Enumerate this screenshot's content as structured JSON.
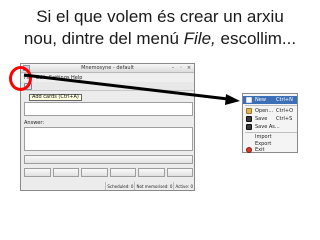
{
  "caption": {
    "line1": "Si el que volem és crear un arxiu",
    "line2_before": "nou, dintre del menú ",
    "line2_menu": "File,",
    "line2_after": " escollim..."
  },
  "window": {
    "title": "Mnemosyne - default",
    "controls": [
      "–",
      "◦",
      "×"
    ],
    "menus": [
      "File",
      "Edit",
      "Settings",
      "Help"
    ],
    "toolbar_icon": "new-card-icon",
    "tooltip": "Add cards (Ctrl+A)",
    "answer_label": "Answer:",
    "status": {
      "scheduled": "Scheduled: 0",
      "not_memorised": "Not memorised: 0",
      "active": "Active: 0"
    }
  },
  "file_menu": {
    "items": [
      {
        "label": "New",
        "shortcut": "Ctrl+N",
        "icon": "new-document-icon",
        "selected": true
      },
      {
        "label": "Open...",
        "shortcut": "Ctrl+O",
        "icon": "open-folder-icon",
        "selected": false
      },
      {
        "label": "Save",
        "shortcut": "Ctrl+S",
        "icon": "save-icon",
        "selected": false
      },
      {
        "label": "Save As...",
        "shortcut": "",
        "icon": "save-as-icon",
        "selected": false
      },
      {
        "label": "Import",
        "shortcut": "",
        "icon": "",
        "selected": false
      },
      {
        "label": "Export",
        "shortcut": "",
        "icon": "",
        "selected": false
      },
      {
        "label": "Exit",
        "shortcut": "",
        "icon": "exit-icon",
        "selected": false
      }
    ]
  },
  "colors": {
    "highlight": "#ff0000",
    "selection": "#3b6fb6",
    "arrow": "#000000"
  }
}
